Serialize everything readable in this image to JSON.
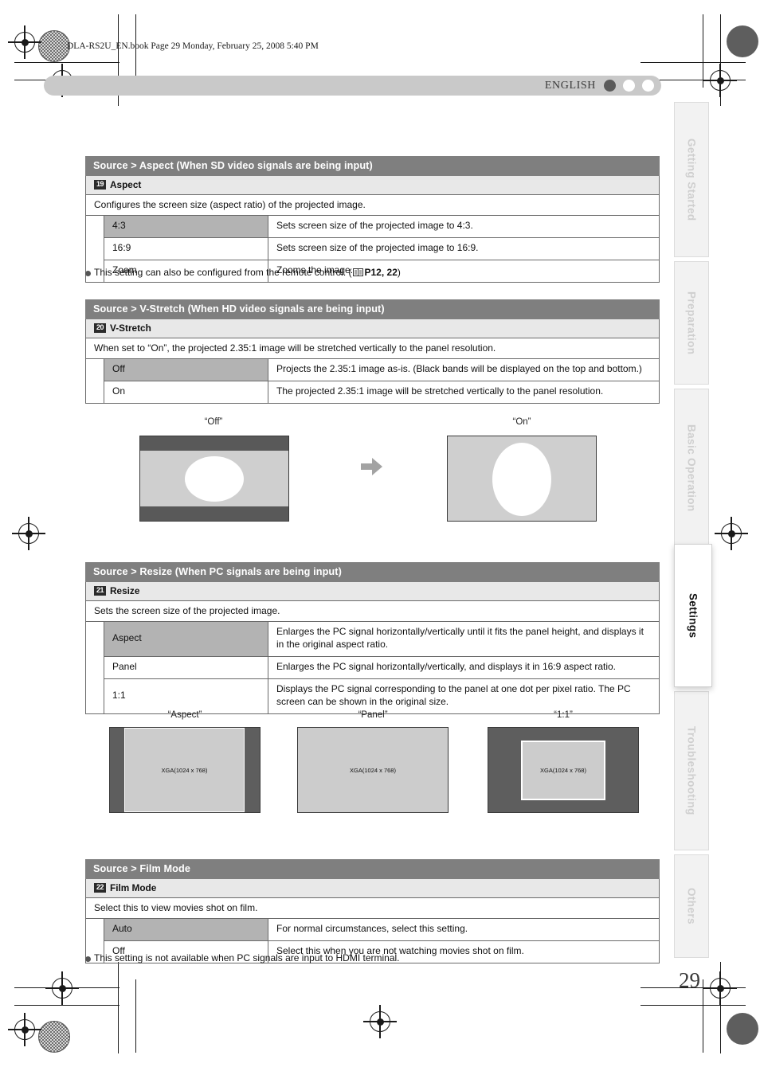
{
  "page": {
    "file_header": "DLA-RS2U_EN.book  Page 29  Monday, February 25, 2008  5:40 PM",
    "language": "ENGLISH",
    "page_number": "29"
  },
  "side_tabs": [
    {
      "label": "Getting Started",
      "active": false
    },
    {
      "label": "Preparation",
      "active": false
    },
    {
      "label": "Basic Operation",
      "active": false
    },
    {
      "label": "Settings",
      "active": true
    },
    {
      "label": "Troubleshooting",
      "active": false
    },
    {
      "label": "Others",
      "active": false
    }
  ],
  "sections": [
    {
      "title": "Source > Aspect (When SD video signals are being input)",
      "badge": "19",
      "subtitle": "Aspect",
      "description": "Configures the screen size (aspect ratio) of the projected image.",
      "options": [
        {
          "name": "4:3",
          "desc": "Sets screen size of the projected image to 4:3.",
          "highlight": true
        },
        {
          "name": "16:9",
          "desc": "Sets screen size of the projected image to 16:9.",
          "highlight": false
        },
        {
          "name": "Zoom",
          "desc": "Zooms the image.",
          "highlight": false
        }
      ]
    },
    {
      "title": "Source > V-Stretch (When HD video signals are being input)",
      "badge": "20",
      "subtitle": "V-Stretch",
      "description": "When set to “On”, the projected 2.35:1 image will be stretched vertically to the panel resolution.",
      "options": [
        {
          "name": "Off",
          "desc": "Projects the 2.35:1 image as-is. (Black bands will be displayed on the top and bottom.)",
          "highlight": true
        },
        {
          "name": "On",
          "desc": "The projected 2.35:1 image will be stretched vertically to the panel resolution.",
          "highlight": false
        }
      ]
    },
    {
      "title": "Source > Resize (When PC signals are being input)",
      "badge": "21",
      "subtitle": "Resize",
      "description": "Sets the screen size of the projected image.",
      "options": [
        {
          "name": "Aspect",
          "desc": "Enlarges the PC signal horizontally/vertically until it fits the panel height, and displays it in the original aspect ratio.",
          "highlight": true
        },
        {
          "name": "Panel",
          "desc": "Enlarges the PC signal horizontally/vertically, and displays it in 16:9 aspect ratio.",
          "highlight": false
        },
        {
          "name": "1:1",
          "desc": "Displays the PC signal corresponding to the panel at one dot per pixel ratio. The PC screen can be shown in the original size.",
          "highlight": false
        }
      ]
    },
    {
      "title": "Source > Film Mode",
      "badge": "22",
      "subtitle": "Film Mode",
      "description": "Select this to view movies shot on film.",
      "options": [
        {
          "name": "Auto",
          "desc": "For normal circumstances, select this setting.",
          "highlight": true
        },
        {
          "name": "Off",
          "desc": "Select this when you are not watching movies shot on film.",
          "highlight": false
        }
      ]
    }
  ],
  "notes": {
    "aspect_note_text": "This setting can also be configured from the remote control. (",
    "aspect_note_ref": "P12, 22",
    "aspect_note_close": ")",
    "film_note": "This setting is not available when PC signals are input to HDMI terminal."
  },
  "illustrations": {
    "vstretch": {
      "off_caption": "“Off”",
      "on_caption": "“On”",
      "arrow": "right-arrow"
    },
    "resize": {
      "panels": [
        {
          "caption": "“Aspect”",
          "label": "XGA(1024 x 768)"
        },
        {
          "caption": "“Panel”",
          "label": "XGA(1024 x 768)"
        },
        {
          "caption": "“1:1”",
          "label": "XGA(1024 x 768)"
        }
      ]
    }
  },
  "colors": {
    "section_header": "#7f7f7f",
    "subheader": "#e8e8e8",
    "highlight_cell": "#b3b3b3",
    "topbar": "#c9c9c9",
    "screen_light": "#cccccc",
    "screen_dark": "#5e5e5e"
  }
}
